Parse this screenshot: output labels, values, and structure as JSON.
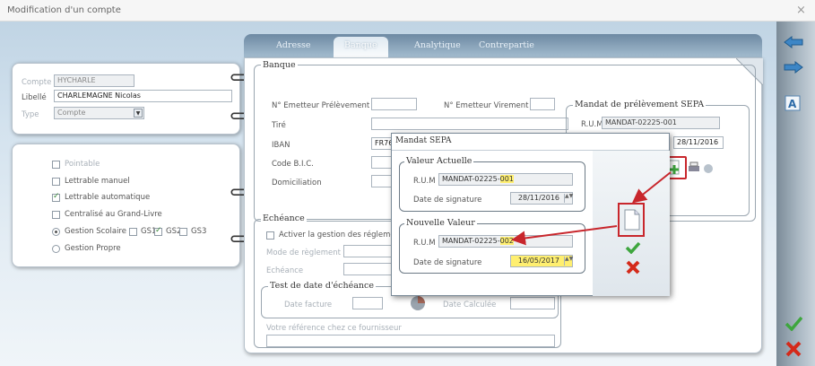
{
  "window": {
    "title": "Modification d'un compte",
    "close": "×"
  },
  "account": {
    "compte_label": "Compte",
    "compte_value": "HYCHARLE",
    "libelle_label": "Libellé",
    "libelle_value": "CHARLEMAGNE Nicolas",
    "type_label": "Type",
    "type_value": "Compte"
  },
  "options": {
    "pointable": "Pointable",
    "lettrable_manuel": "Lettrable manuel",
    "lettrable_auto": "Lettrable automatique",
    "centralise": "Centralisé au Grand-Livre",
    "gestion_scolaire": "Gestion Scolaire",
    "gs1": "GS1",
    "gs2": "GS2",
    "gs3": "GS3",
    "gestion_propre": "Gestion Propre"
  },
  "tabs": [
    "Adresse",
    "Banque",
    "Analytique",
    "Contrepartie"
  ],
  "banque": {
    "title": "Banque",
    "emetteur_prelevement": "N° Emetteur Prélèvement",
    "emetteur_virement": "N° Emetteur Virement",
    "tire": "Tiré",
    "iban": "IBAN",
    "iban_value": "FR76",
    "bic": "Code B.I.C.",
    "domiciliation": "Domiciliation"
  },
  "sepa": {
    "title": "Mandat de prélèvement SEPA",
    "rum_label": "R.U.M",
    "rum_value": "MANDAT-02225-001",
    "date_value": "28/11/2016"
  },
  "echeance": {
    "title": "Echéance",
    "activer": "Activer la gestion des réglemen",
    "mode": "Mode de règlement",
    "echeance": "Echéance",
    "test_title": "Test de date d'échéance",
    "date_facture": "Date facture",
    "date_calculee": "Date Calculée",
    "votre_ref": "Votre référence chez ce fournisseur"
  },
  "dialog": {
    "title": "Mandat SEPA",
    "actuelle_title": "Valeur Actuelle",
    "rum_label": "R.U.M",
    "rum_actuel_prefix": "MANDAT-02225-",
    "rum_actuel_suffix": "001",
    "date_label": "Date de signature",
    "date_actuelle": "28/11/2016",
    "nouvelle_title": "Nouvelle Valeur",
    "rum_nouveau_prefix": "MANDAT-02225-",
    "rum_nouveau_suffix": "002",
    "date_nouvelle": "16/05/2017"
  },
  "colors": {
    "highlight": "#ffef70",
    "annotation": "#c8262c",
    "ok": "#3ea63e",
    "cancel": "#d42a1a"
  }
}
